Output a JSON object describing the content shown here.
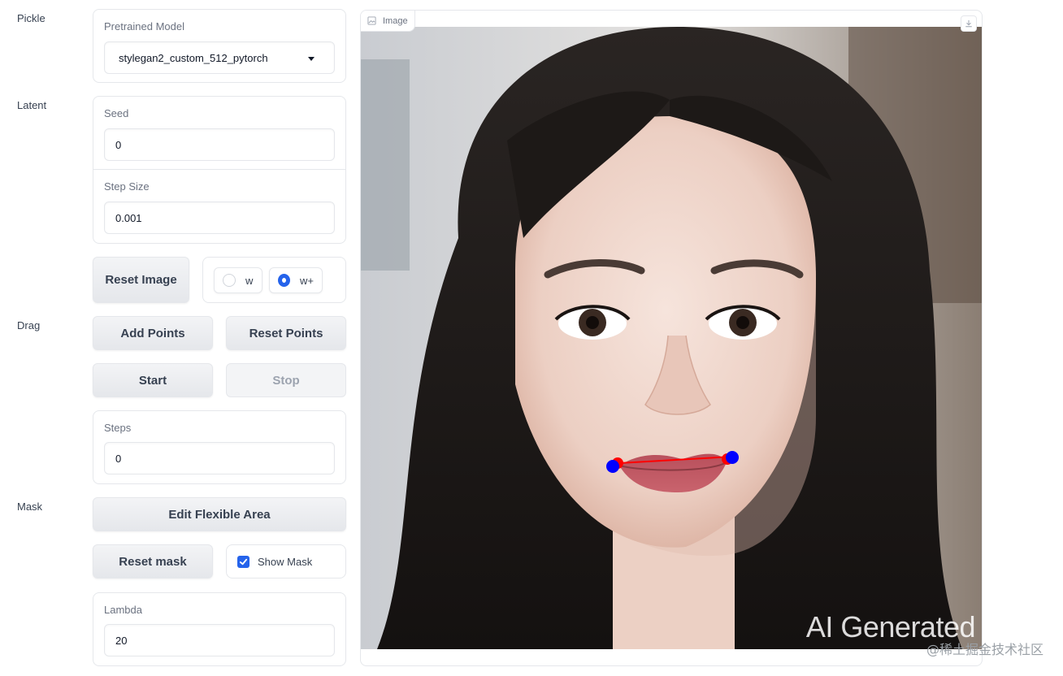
{
  "sections": {
    "pickle": "Pickle",
    "latent": "Latent",
    "drag": "Drag",
    "mask": "Mask"
  },
  "pretrained_model": {
    "label": "Pretrained Model",
    "value": "stylegan2_custom_512_pytorch"
  },
  "seed": {
    "label": "Seed",
    "value": "0"
  },
  "step_size": {
    "label": "Step Size",
    "value": "0.001"
  },
  "reset_image_label": "Reset Image",
  "latent_space": {
    "options": [
      "w",
      "w+"
    ],
    "selected": "w+"
  },
  "drag_buttons": {
    "add_points": "Add Points",
    "reset_points": "Reset Points",
    "start": "Start",
    "stop": "Stop"
  },
  "steps": {
    "label": "Steps",
    "value": "0"
  },
  "mask_controls": {
    "edit_flexible_area": "Edit Flexible Area",
    "reset_mask": "Reset mask",
    "show_mask_label": "Show Mask",
    "show_mask_checked": true
  },
  "lambda": {
    "label": "Lambda",
    "value": "20"
  },
  "image_panel": {
    "tab_label": "Image",
    "watermark": "AI Generated",
    "site_mark": "@稀土掘金技术社区",
    "handle_color": "#ff0000",
    "target_color": "#0000ff"
  }
}
